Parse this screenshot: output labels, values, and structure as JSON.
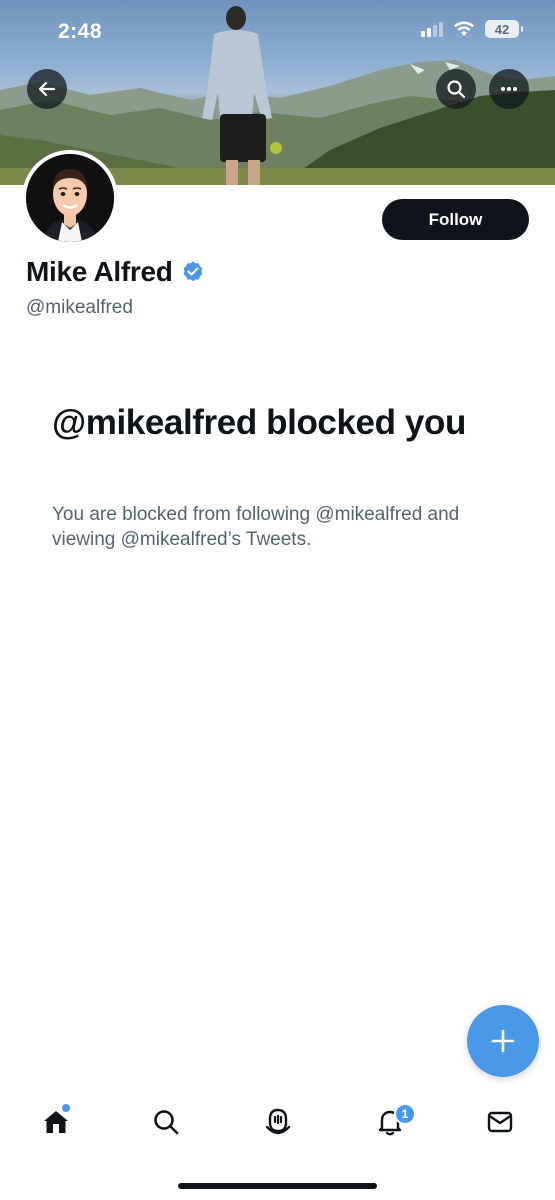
{
  "status_bar": {
    "time": "2:48",
    "battery": "42"
  },
  "header": {
    "back_icon": "arrow-left-icon",
    "search_icon": "search-icon",
    "more_icon": "more-horizontal-icon"
  },
  "profile": {
    "display_name": "Mike Alfred",
    "handle": "@mikealfred",
    "verified": true,
    "follow_label": "Follow"
  },
  "blocked_notice": {
    "title": "@mikealfred blocked you",
    "description": "You are blocked from following @mikealfred and viewing @mikealfred’s Tweets."
  },
  "compose": {
    "icon": "plus-icon"
  },
  "bottom_nav": {
    "items": [
      {
        "icon": "home-icon",
        "has_dot": true
      },
      {
        "icon": "search-icon"
      },
      {
        "icon": "spaces-icon"
      },
      {
        "icon": "bell-icon",
        "badge": "1"
      },
      {
        "icon": "mail-icon"
      }
    ]
  },
  "colors": {
    "accent": "#4a99e9",
    "text_primary": "#0f1419",
    "text_secondary": "#536471",
    "button_dark": "#0f1419"
  }
}
